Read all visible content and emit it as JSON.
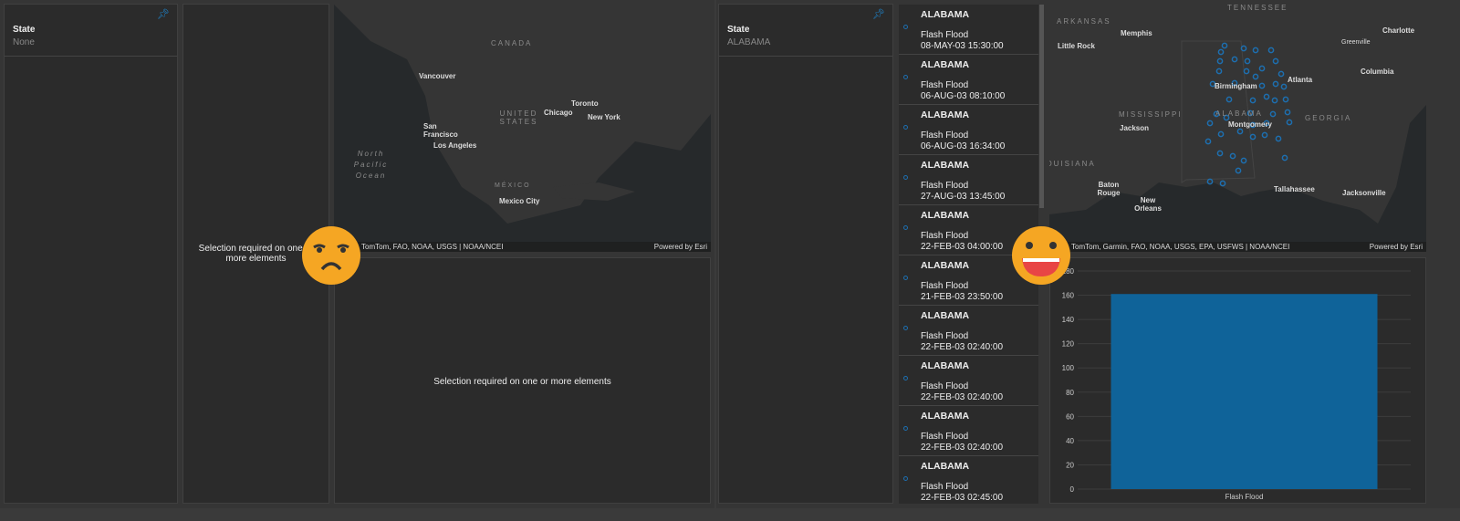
{
  "left": {
    "filter": {
      "title": "State",
      "value": "None"
    },
    "list_message": "Selection required on one or more elements",
    "chart_message": "Selection required on one or more elements",
    "map": {
      "labels": [
        "Vancouver",
        "San Francisco",
        "Los Angeles",
        "Chicago",
        "Toronto",
        "New York",
        "Mexico City"
      ],
      "regions": [
        "CANADA",
        "UNITED STATES",
        "MÉXICO",
        "North Pacific Ocean"
      ],
      "attribution": "TomTom, FAO, NOAA, USGS | NOAA/NCEI",
      "powered": "Powered by Esri"
    },
    "emoji": "frowning-face"
  },
  "right": {
    "filter": {
      "title": "State",
      "value": "ALABAMA"
    },
    "list": [
      {
        "state": "ALABAMA",
        "type": "Flash Flood",
        "date": "08-MAY-03 15:30:00"
      },
      {
        "state": "ALABAMA",
        "type": "Flash Flood",
        "date": "06-AUG-03 08:10:00"
      },
      {
        "state": "ALABAMA",
        "type": "Flash Flood",
        "date": "06-AUG-03 16:34:00"
      },
      {
        "state": "ALABAMA",
        "type": "Flash Flood",
        "date": "27-AUG-03 13:45:00"
      },
      {
        "state": "ALABAMA",
        "type": "Flash Flood",
        "date": "22-FEB-03 04:00:00"
      },
      {
        "state": "ALABAMA",
        "type": "Flash Flood",
        "date": "21-FEB-03 23:50:00"
      },
      {
        "state": "ALABAMA",
        "type": "Flash Flood",
        "date": "22-FEB-03 02:40:00"
      },
      {
        "state": "ALABAMA",
        "type": "Flash Flood",
        "date": "22-FEB-03 02:40:00"
      },
      {
        "state": "ALABAMA",
        "type": "Flash Flood",
        "date": "22-FEB-03 02:40:00"
      },
      {
        "state": "ALABAMA",
        "type": "Flash Flood",
        "date": "22-FEB-03 02:45:00"
      }
    ],
    "map": {
      "labels": [
        "Memphis",
        "Little Rock",
        "Charlotte",
        "Greenville",
        "Columbia",
        "Atlanta",
        "Birmingham",
        "Montgomery",
        "Jackson",
        "Baton Rouge",
        "New Orleans",
        "Tallahassee",
        "Jacksonville"
      ],
      "regions": [
        "ARKANSAS",
        "TENNESSEE",
        "MISSISSIPPI",
        "ALABAMA",
        "GEORGIA",
        "LOUISIANA"
      ],
      "attribution": "TomTom, Garmin, FAO, NOAA, USGS, EPA, USFWS | NOAA/NCEI",
      "powered": "Powered by Esri"
    },
    "emoji": "grinning-face"
  },
  "chart_data": {
    "type": "bar",
    "categories": [
      "Flash Flood"
    ],
    "values": [
      161
    ],
    "title": "",
    "xlabel": "",
    "ylabel": "",
    "ylim": [
      0,
      180
    ],
    "yticks": [
      0,
      20,
      40,
      60,
      80,
      100,
      120,
      140,
      160,
      180
    ],
    "grid": true,
    "color": "#0f6399"
  }
}
